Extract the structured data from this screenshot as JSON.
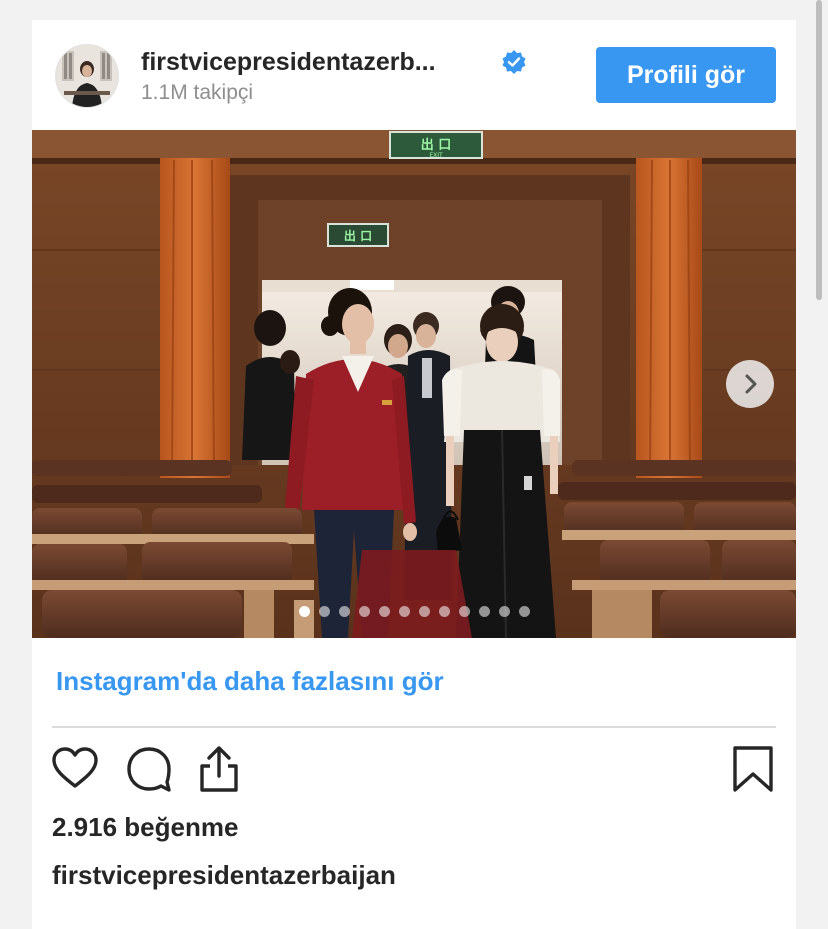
{
  "header": {
    "username": "firstvicepresidentazerb...",
    "followers": "1.1M takipçi",
    "profile_button": "Profili gör",
    "verified_icon": "verified-badge-icon",
    "accent_color": "#3897f0"
  },
  "carousel": {
    "slide_count": 12,
    "active_index": 0,
    "next_icon": "chevron-right-icon"
  },
  "photo_signs": {
    "exit_sign_1": "出 口",
    "exit_sign_1_sub": "EXIT",
    "exit_sign_2": "出 口"
  },
  "more_link": "Instagram'da daha fazlasını gör",
  "actions": {
    "like_icon": "heart-icon",
    "comment_icon": "comment-icon",
    "share_icon": "share-icon",
    "save_icon": "bookmark-icon"
  },
  "likes": "2.916 beğenme",
  "caption_user": "firstvicepresidentazerbaijan"
}
